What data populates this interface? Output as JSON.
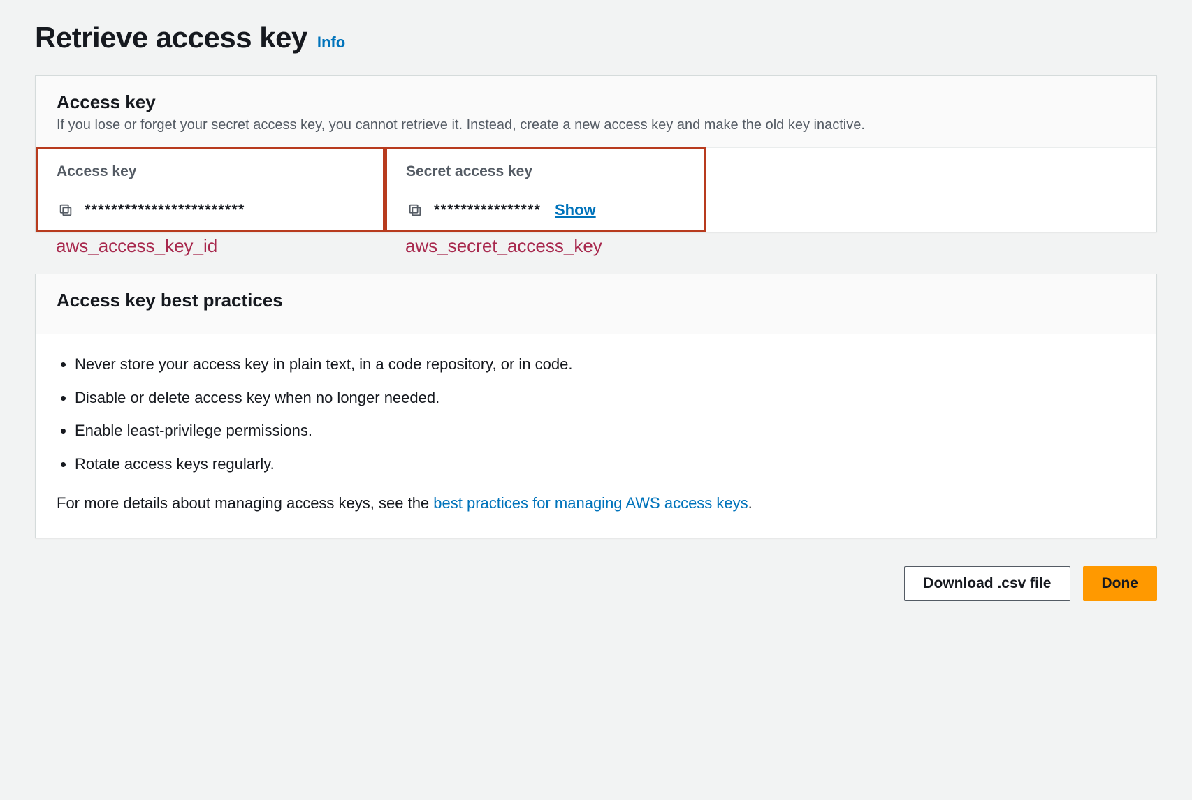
{
  "page": {
    "title": "Retrieve access key",
    "info_label": "Info"
  },
  "access_key_panel": {
    "heading": "Access key",
    "subtitle": "If you lose or forget your secret access key, you cannot retrieve it. Instead, create a new access key and make the old key inactive.",
    "columns": {
      "access_key": {
        "label": "Access key",
        "masked_value": "************************"
      },
      "secret_key": {
        "label": "Secret access key",
        "masked_value": "****************",
        "show_label": "Show"
      }
    }
  },
  "annotations": {
    "access_key": "aws_access_key_id",
    "secret_key": "aws_secret_access_key"
  },
  "best_practices": {
    "heading": "Access key best practices",
    "items": [
      "Never store your access key in plain text, in a code repository, or in code.",
      "Disable or delete access key when no longer needed.",
      "Enable least-privilege permissions.",
      "Rotate access keys regularly."
    ],
    "footer_prefix": "For more details about managing access keys, see the ",
    "footer_link": "best practices for managing AWS access keys",
    "footer_suffix": "."
  },
  "actions": {
    "download": "Download .csv file",
    "done": "Done"
  }
}
